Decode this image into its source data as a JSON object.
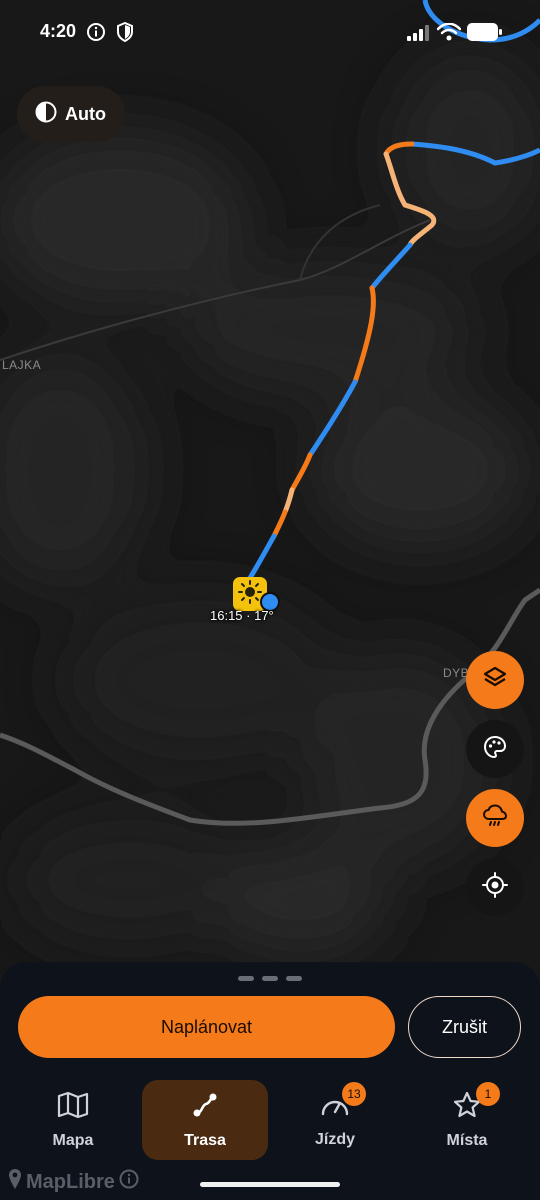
{
  "status_bar": {
    "time": "4:20",
    "icons": [
      "info-icon",
      "shield-icon",
      "signal-icon",
      "wifi-icon",
      "battery-icon"
    ]
  },
  "map": {
    "theme_toggle": {
      "label": "Auto",
      "icon": "contrast-icon"
    },
    "labels": {
      "left": "LAJKA",
      "right": "DYB"
    },
    "marker": {
      "icon": "sun-icon",
      "text": "16:15 · 17°"
    },
    "route_colors": {
      "blue": "#2f8cf0",
      "orange": "#f47a1a",
      "light": "#f6b377"
    },
    "controls": [
      "layers-icon",
      "palette-icon",
      "weather-rain-icon",
      "locate-icon"
    ]
  },
  "sheet": {
    "plan_label": "Naplánovat",
    "cancel_label": "Zrušit"
  },
  "nav": {
    "items": [
      {
        "label": "Mapa",
        "icon": "map-icon",
        "active": false
      },
      {
        "label": "Trasa",
        "icon": "route-icon",
        "active": true
      },
      {
        "label": "Jízdy",
        "icon": "speedometer-icon",
        "active": false,
        "badge": "13"
      },
      {
        "label": "Místa",
        "icon": "star-icon",
        "active": false,
        "badge": "1"
      }
    ]
  },
  "attribution": {
    "label": "MapLibre"
  },
  "colors": {
    "accent": "#f47a1a",
    "sheet_bg": "#0e121b",
    "active_tab_bg": "#4a2a10"
  }
}
